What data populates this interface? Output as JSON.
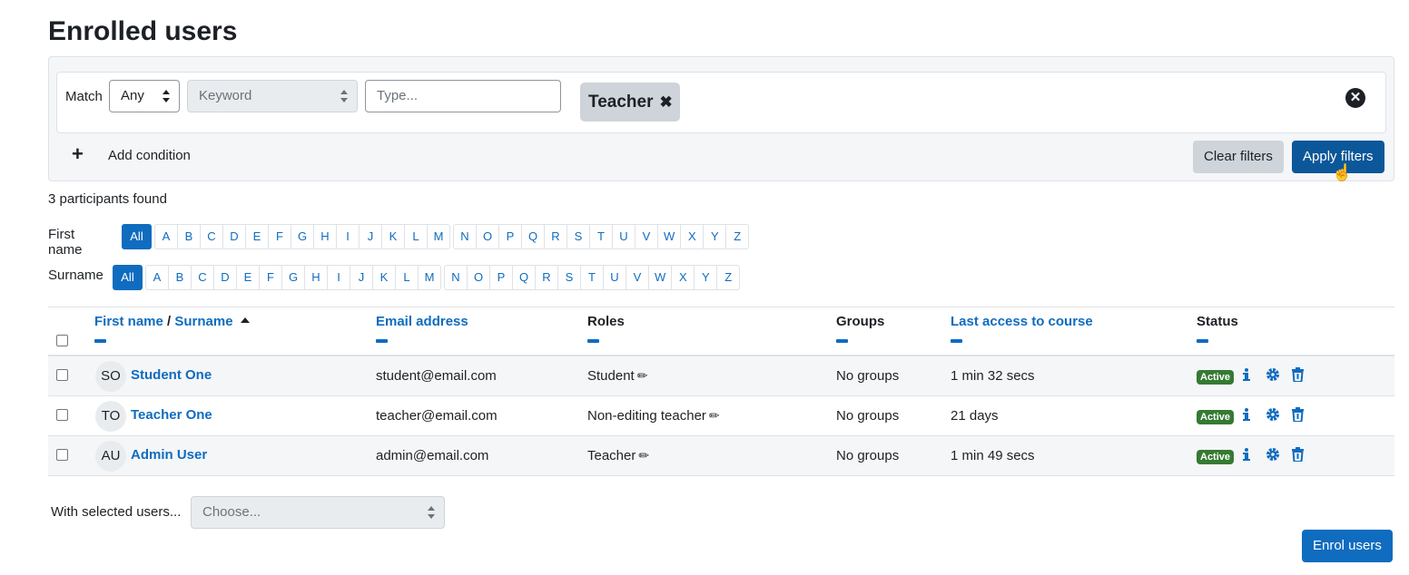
{
  "page": {
    "title": "Enrolled users"
  },
  "filter": {
    "match_label": "Match",
    "match_value": "Any",
    "type_placeholder": "Keyword",
    "value_placeholder": "Type...",
    "tag_label": "Teacher",
    "add_condition_label": "Add condition",
    "clear_label": "Clear filters",
    "apply_label": "Apply filters"
  },
  "participants_found": "3 participants found",
  "initials": {
    "all_label": "All",
    "first_name_label": "First name",
    "surname_label": "Surname",
    "letters_group1": [
      "A",
      "B",
      "C",
      "D",
      "E",
      "F",
      "G",
      "H",
      "I",
      "J",
      "K",
      "L",
      "M"
    ],
    "letters_group2": [
      "N",
      "O",
      "P",
      "Q",
      "R",
      "S",
      "T",
      "U",
      "V",
      "W",
      "X",
      "Y",
      "Z"
    ]
  },
  "table": {
    "headers": {
      "first_name": "First name",
      "separator": " / ",
      "surname": "Surname",
      "email": "Email address",
      "roles": "Roles",
      "groups": "Groups",
      "last_access": "Last access to course",
      "status": "Status"
    },
    "rows": [
      {
        "initials": "SO",
        "name": "Student One",
        "email": "student@email.com",
        "role": "Student",
        "groups": "No groups",
        "last_access": "1 min 32 secs",
        "status": "Active"
      },
      {
        "initials": "TO",
        "name": "Teacher One",
        "email": "teacher@email.com",
        "role": "Non-editing teacher",
        "groups": "No groups",
        "last_access": "21 days",
        "status": "Active"
      },
      {
        "initials": "AU",
        "name": "Admin User",
        "email": "admin@email.com",
        "role": "Teacher",
        "groups": "No groups",
        "last_access": "1 min 49 secs",
        "status": "Active"
      }
    ]
  },
  "bulk": {
    "label": "With selected users...",
    "placeholder": "Choose..."
  },
  "enrol_label": "Enrol users",
  "colors": {
    "primary": "#0f6cbf",
    "active_badge": "#357a32",
    "secondary": "#ced4da"
  }
}
